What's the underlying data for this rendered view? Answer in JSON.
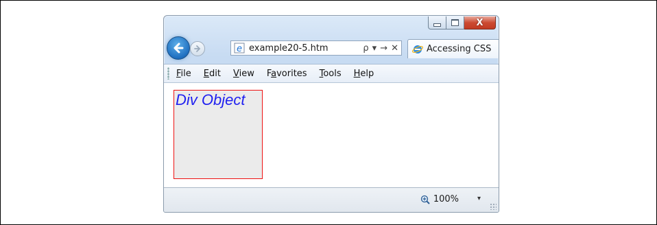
{
  "browser": {
    "address": "example20-5.htm",
    "tab_title": "Accessing CSS",
    "caption_close": "X",
    "tools": {
      "search_icon": "search-icon",
      "dropdown_icon": "chevron-down-icon",
      "go_icon": "arrow-right-icon",
      "stop_icon": "close-icon",
      "search_glyph": "ρ",
      "dropdown_glyph": "▾",
      "go_glyph": "→",
      "stop_glyph": "✕"
    }
  },
  "menu": {
    "items": [
      {
        "label": "File"
      },
      {
        "label": "Edit"
      },
      {
        "label": "View"
      },
      {
        "label": "Favorites"
      },
      {
        "label": "Tools"
      },
      {
        "label": "Help"
      }
    ]
  },
  "page": {
    "div_label": "Div Object"
  },
  "status": {
    "zoom": "100%",
    "zoom_dropdown_glyph": "▾"
  },
  "colors": {
    "div_border": "#ee1111",
    "div_background": "#ebebeb",
    "div_text": "#1f1ff0",
    "close_button": "#cc4b32"
  }
}
